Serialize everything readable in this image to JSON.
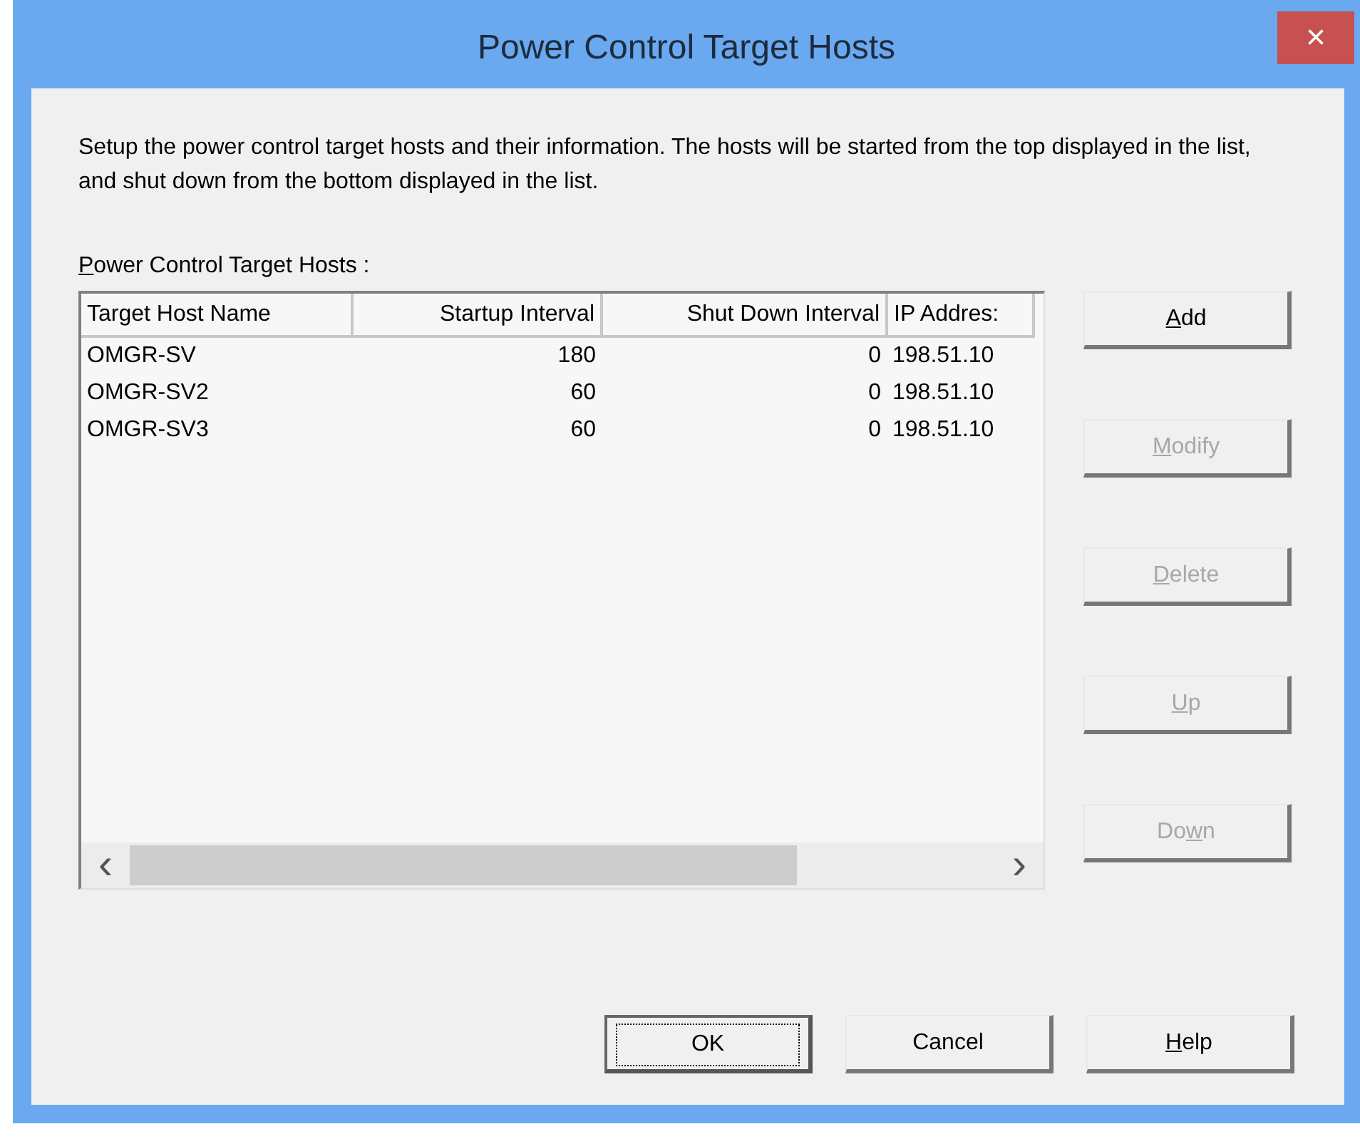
{
  "window": {
    "title": "Power Control Target Hosts",
    "close": "×"
  },
  "description": "Setup the power control target hosts and their information. The hosts will be started from the top displayed in the list, and shut down from the bottom displayed in the list.",
  "list_label": {
    "segments": [
      {
        "text": "P",
        "underlined": true
      },
      {
        "text": "ower Control Target Hosts :",
        "underlined": false
      }
    ]
  },
  "table": {
    "columns": [
      "Target Host Name",
      "Startup Interval",
      "Shut Down Interval",
      "IP Addres:"
    ],
    "rows": [
      [
        "OMGR-SV",
        "180",
        "0",
        "198.51.10"
      ],
      [
        "OMGR-SV2",
        "60",
        "0",
        "198.51.10"
      ],
      [
        "OMGR-SV3",
        "60",
        "0",
        "198.51.10"
      ]
    ],
    "scroll_left": "‹",
    "scroll_right": "›"
  },
  "side_buttons": [
    {
      "segments": [
        {
          "text": "A",
          "underlined": true
        },
        {
          "text": "dd",
          "underlined": false
        }
      ],
      "disabled": false
    },
    {
      "segments": [
        {
          "text": "M",
          "underlined": true
        },
        {
          "text": "odify",
          "underlined": false
        }
      ],
      "disabled": true
    },
    {
      "segments": [
        {
          "text": "D",
          "underlined": true
        },
        {
          "text": "elete",
          "underlined": false
        }
      ],
      "disabled": true
    },
    {
      "segments": [
        {
          "text": "U",
          "underlined": true
        },
        {
          "text": "p",
          "underlined": false
        }
      ],
      "disabled": true
    },
    {
      "segments": [
        {
          "text": "Do",
          "underlined": false
        },
        {
          "text": "w",
          "underlined": true
        },
        {
          "text": "n",
          "underlined": false
        }
      ],
      "disabled": true
    }
  ],
  "bottom_buttons": [
    {
      "segments": [
        {
          "text": "OK",
          "underlined": false
        }
      ],
      "default": true
    },
    {
      "segments": [
        {
          "text": "Cancel",
          "underlined": false
        }
      ],
      "default": false
    },
    {
      "segments": [
        {
          "text": "H",
          "underlined": true
        },
        {
          "text": "elp",
          "underlined": false
        }
      ],
      "default": false
    }
  ]
}
